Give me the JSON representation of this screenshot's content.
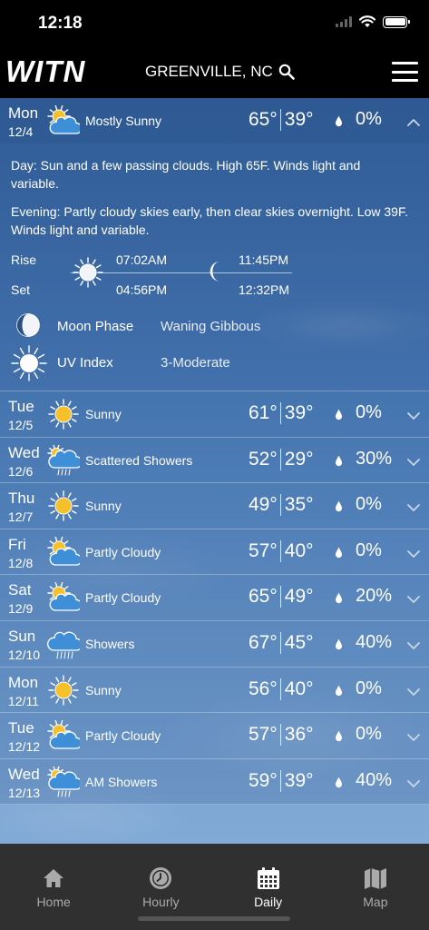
{
  "status_bar": {
    "time": "12:18"
  },
  "header": {
    "logo": "WITN",
    "location": "GREENVILLE, NC"
  },
  "days": [
    {
      "dow": "Mon",
      "date": "12/4",
      "icon": "partly-sunny-icon",
      "condition": "Mostly Sunny",
      "high": "65°",
      "low": "39°",
      "precip": "0%",
      "expanded": true
    },
    {
      "dow": "Tue",
      "date": "12/5",
      "icon": "sun-icon",
      "condition": "Sunny",
      "high": "61°",
      "low": "39°",
      "precip": "0%"
    },
    {
      "dow": "Wed",
      "date": "12/6",
      "icon": "showers-icon",
      "condition": "Scattered Showers",
      "high": "52°",
      "low": "29°",
      "precip": "30%"
    },
    {
      "dow": "Thu",
      "date": "12/7",
      "icon": "sun-icon",
      "condition": "Sunny",
      "high": "49°",
      "low": "35°",
      "precip": "0%"
    },
    {
      "dow": "Fri",
      "date": "12/8",
      "icon": "partly-cloudy-icon",
      "condition": "Partly Cloudy",
      "high": "57°",
      "low": "40°",
      "precip": "0%"
    },
    {
      "dow": "Sat",
      "date": "12/9",
      "icon": "partly-cloudy-icon",
      "condition": "Partly Cloudy",
      "high": "65°",
      "low": "49°",
      "precip": "20%"
    },
    {
      "dow": "Sun",
      "date": "12/10",
      "icon": "rain-cloud-icon",
      "condition": "Showers",
      "high": "67°",
      "low": "45°",
      "precip": "40%"
    },
    {
      "dow": "Mon",
      "date": "12/11",
      "icon": "sun-icon",
      "condition": "Sunny",
      "high": "56°",
      "low": "40°",
      "precip": "0%"
    },
    {
      "dow": "Tue",
      "date": "12/12",
      "icon": "partly-cloudy-icon",
      "condition": "Partly Cloudy",
      "high": "57°",
      "low": "36°",
      "precip": "0%"
    },
    {
      "dow": "Wed",
      "date": "12/13",
      "icon": "showers-icon",
      "condition": "AM Showers",
      "high": "59°",
      "low": "39°",
      "precip": "40%"
    }
  ],
  "detail": {
    "day_label": "Day",
    "day_text": ": Sun and a few passing clouds. High 65F. Winds light and variable.",
    "evening_label": "Evening",
    "evening_text": ": Partly cloudy skies early, then clear skies overnight. Low 39F. Winds light and variable.",
    "rise_label": "Rise",
    "set_label": "Set",
    "sunrise": "07:02AM",
    "sunset": "04:56PM",
    "moonrise": "11:45PM",
    "moonset": "12:32PM",
    "moon_phase_label": "Moon Phase",
    "moon_phase_value": "Waning Gibbous",
    "uv_label": "UV Index",
    "uv_value": "3-Moderate"
  },
  "tabs": [
    {
      "label": "Home",
      "icon": "home-icon",
      "active": false
    },
    {
      "label": "Hourly",
      "icon": "clock-icon",
      "active": false
    },
    {
      "label": "Daily",
      "icon": "calendar-icon",
      "active": true
    },
    {
      "label": "Map",
      "icon": "map-icon",
      "active": false
    }
  ],
  "colors": {
    "header_bg": "#000000",
    "tabbar_bg": "#303030",
    "sun": "#f5c02a",
    "cloud": "#3f8fd8"
  }
}
